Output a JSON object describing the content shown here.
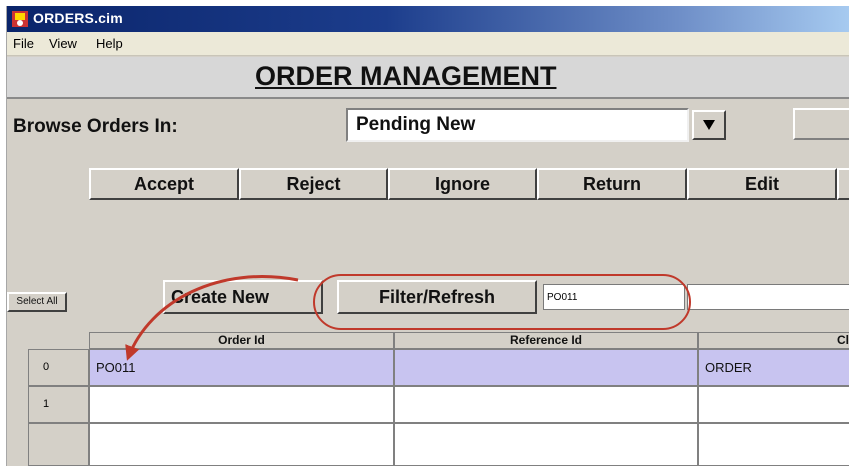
{
  "window": {
    "title": "ORDERS.cim"
  },
  "menu": {
    "items": [
      "File",
      "View",
      "Help"
    ]
  },
  "heading": "ORDER MANAGEMENT",
  "browse": {
    "label": "Browse Orders In:",
    "selected": "Pending New"
  },
  "actions": [
    "Accept",
    "Reject",
    "Ignore",
    "Return",
    "Edit"
  ],
  "toolbar": {
    "select_all": "Select All",
    "create_new": "Create New",
    "filter_refresh": "Filter/Refresh",
    "filter_value": "PO011"
  },
  "grid": {
    "columns": [
      "Order Id",
      "Reference Id",
      "Cl"
    ],
    "rows": [
      {
        "num": "0",
        "order_id": "PO011",
        "reference_id": "",
        "cl": "ORDER"
      },
      {
        "num": "1",
        "order_id": "",
        "reference_id": "",
        "cl": ""
      }
    ]
  },
  "colors": {
    "highlight": "#c0392b",
    "selected_row": "#c8c4f0",
    "titlebar": "#0a246a"
  }
}
